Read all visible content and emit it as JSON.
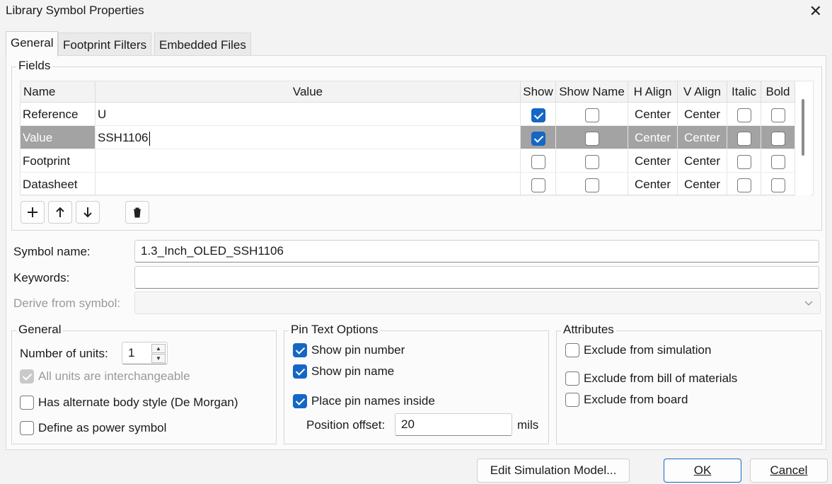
{
  "window": {
    "title": "Library Symbol Properties",
    "close_glyph": "✕"
  },
  "tabs": [
    {
      "label": "General",
      "active": true
    },
    {
      "label": "Footprint Filters",
      "active": false
    },
    {
      "label": "Embedded Files",
      "active": false
    }
  ],
  "fields": {
    "group_title": "Fields",
    "columns": [
      "Name",
      "Value",
      "Show",
      "Show Name",
      "H Align",
      "V Align",
      "Italic",
      "Bold"
    ],
    "rows": [
      {
        "name": "Reference",
        "value": "U",
        "show": true,
        "show_name": false,
        "h_align": "Center",
        "v_align": "Center",
        "italic": false,
        "bold": false
      },
      {
        "name": "Value",
        "value": "SSH1106",
        "show": true,
        "show_name": false,
        "h_align": "Center",
        "v_align": "Center",
        "italic": false,
        "bold": false,
        "selected": true
      },
      {
        "name": "Footprint",
        "value": "",
        "show": false,
        "show_name": false,
        "h_align": "Center",
        "v_align": "Center",
        "italic": false,
        "bold": false
      },
      {
        "name": "Datasheet",
        "value": "",
        "show": false,
        "show_name": false,
        "h_align": "Center",
        "v_align": "Center",
        "italic": false,
        "bold": false
      }
    ],
    "toolbar_icons": [
      "add-icon",
      "move-up-icon",
      "move-down-icon",
      "trash-icon"
    ]
  },
  "symbol": {
    "name_label": "Symbol name:",
    "name_value": "1.3_Inch_OLED_SSH1106",
    "keywords_label": "Keywords:",
    "keywords_value": "",
    "derive_label": "Derive from symbol:",
    "derive_value": ""
  },
  "general": {
    "title": "General",
    "units_label": "Number of units:",
    "units_value": "1",
    "interchangeable_label": "All units are interchangeable",
    "interchangeable_checked": true,
    "alternate_label": "Has alternate body style (De Morgan)",
    "alternate_checked": false,
    "power_label": "Define as power symbol",
    "power_checked": false
  },
  "pin_text": {
    "title": "Pin Text Options",
    "show_number_label": "Show pin number",
    "show_number_checked": true,
    "show_name_label": "Show pin name",
    "show_name_checked": true,
    "inside_label": "Place pin names inside",
    "inside_checked": true,
    "offset_label": "Position offset:",
    "offset_value": "20",
    "offset_unit": "mils"
  },
  "attributes": {
    "title": "Attributes",
    "sim_label": "Exclude from simulation",
    "sim_checked": false,
    "bom_label": "Exclude from bill of materials",
    "bom_checked": false,
    "board_label": "Exclude from board",
    "board_checked": false
  },
  "buttons": {
    "edit_sim": "Edit Simulation Model...",
    "ok": "OK",
    "cancel": "Cancel"
  },
  "colors": {
    "accent": "#1467c4",
    "selected_row": "#a3a3a3"
  }
}
